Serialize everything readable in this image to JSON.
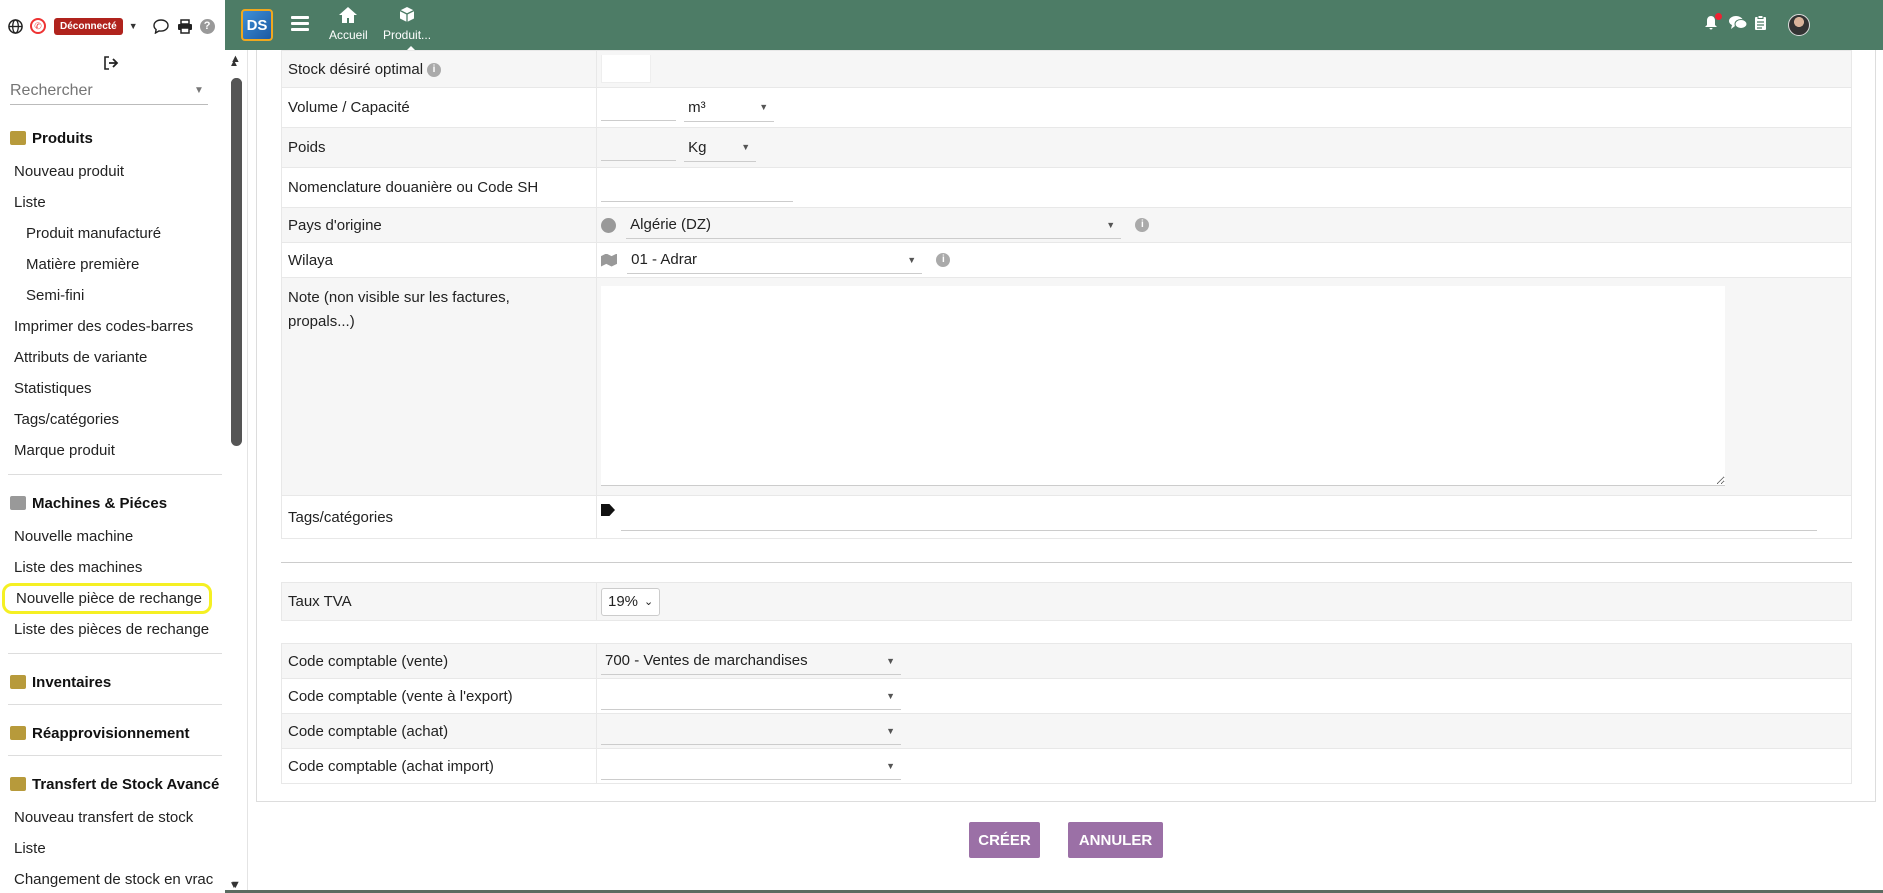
{
  "sidebar": {
    "status_badge": "Déconnecté",
    "search_placeholder": "Rechercher",
    "sections": [
      {
        "title": "Produits",
        "icon": "box-icon",
        "color": "#b79a3b",
        "items": [
          {
            "label": "Nouveau produit",
            "sub": false
          },
          {
            "label": "Liste",
            "sub": false
          },
          {
            "label": "Produit manufacturé",
            "sub": true
          },
          {
            "label": "Matière première",
            "sub": true
          },
          {
            "label": "Semi-fini",
            "sub": true
          },
          {
            "label": "Imprimer des codes-barres",
            "sub": false
          },
          {
            "label": "Attributs de variante",
            "sub": false
          },
          {
            "label": "Statistiques",
            "sub": false
          },
          {
            "label": "Tags/catégories",
            "sub": false
          },
          {
            "label": "Marque produit",
            "sub": false
          }
        ]
      },
      {
        "title": "Machines & Piéces",
        "icon": "gears-icon",
        "color": "#999999",
        "items": [
          {
            "label": "Nouvelle machine",
            "sub": false
          },
          {
            "label": "Liste des machines",
            "sub": false
          },
          {
            "label": "Nouvelle pièce de rechange",
            "sub": false,
            "highlighted": true
          },
          {
            "label": "Liste des pièces de rechange",
            "sub": false
          }
        ]
      },
      {
        "title": "Inventaires",
        "icon": "boxes-icon",
        "color": "#b79a3b",
        "items": []
      },
      {
        "title": "Réapprovisionnement",
        "icon": "boxes-icon",
        "color": "#b79a3b",
        "items": []
      },
      {
        "title": "Transfert de Stock Avancé",
        "icon": "boxes-icon",
        "color": "#b79a3b",
        "items": [
          {
            "label": "Nouveau transfert de stock",
            "sub": false
          },
          {
            "label": "Liste",
            "sub": false
          },
          {
            "label": "Changement de stock en vrac",
            "sub": false
          }
        ]
      }
    ]
  },
  "topbar": {
    "logo_text": "DS",
    "nav": [
      {
        "label": "Accueil",
        "icon": "home-icon"
      },
      {
        "label": "Produit...",
        "icon": "cube-icon"
      }
    ],
    "bg_color": "#4d7c66"
  },
  "form": {
    "rows": [
      {
        "label": "Stock désiré optimal",
        "info": true
      },
      {
        "label": "Volume / Capacité",
        "unit": "m³"
      },
      {
        "label": "Poids",
        "unit": "Kg"
      },
      {
        "label": "Nomenclature douanière ou Code SH"
      },
      {
        "label": "Pays d'origine",
        "value": "Algérie (DZ)"
      },
      {
        "label": "Wilaya",
        "value": "01 - Adrar"
      },
      {
        "label": "Note (non visible sur les factures, propals...)"
      },
      {
        "label": "Tags/catégories"
      }
    ],
    "tva": {
      "label": "Taux TVA",
      "value": "19%"
    },
    "accounting": [
      {
        "label": "Code comptable (vente)",
        "value": "700 - Ventes de marchandises"
      },
      {
        "label": "Code comptable (vente à l'export)",
        "value": ""
      },
      {
        "label": "Code comptable (achat)",
        "value": ""
      },
      {
        "label": "Code comptable (achat import)",
        "value": ""
      }
    ]
  },
  "buttons": {
    "create": "CRÉER",
    "cancel": "ANNULER",
    "color": "#9b70a6"
  }
}
